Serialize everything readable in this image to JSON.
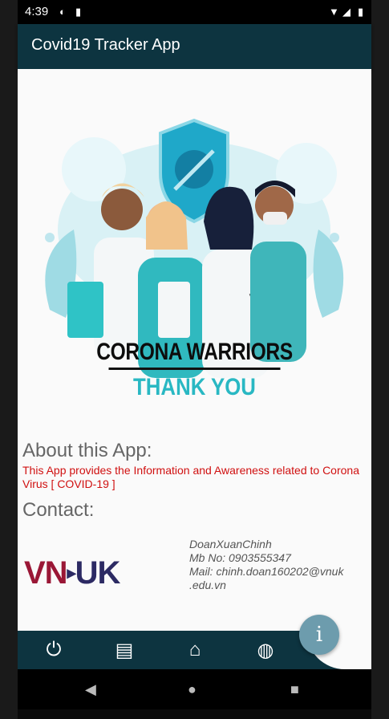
{
  "status": {
    "time": "4:39"
  },
  "appbar": {
    "title": "Covid19 Tracker App"
  },
  "hero": {
    "title": "CORONA WARRIORS",
    "subtitle": "THANK YOU"
  },
  "about": {
    "heading": "About this App:",
    "text": "This App provides the Information and Awareness related to Corona Virus [ COVID-19 ]"
  },
  "contact": {
    "heading": "Contact:",
    "logo_left": "VN",
    "logo_right": "UK",
    "lines": [
      "DoanXuanChinh",
      " Mb No:  0903555347",
      " Mail: chinh.doan160202@vnuk",
      ".edu.vn"
    ]
  },
  "colors": {
    "appbar": "#0d3440",
    "accent": "#29b8c3",
    "about_text": "#d01010",
    "fab": "#6d9cad"
  },
  "bottom_nav": {
    "icons": [
      "power-icon",
      "news-icon",
      "home-icon",
      "globe-icon"
    ]
  },
  "fab": {
    "icon": "info-icon",
    "glyph": "i"
  }
}
